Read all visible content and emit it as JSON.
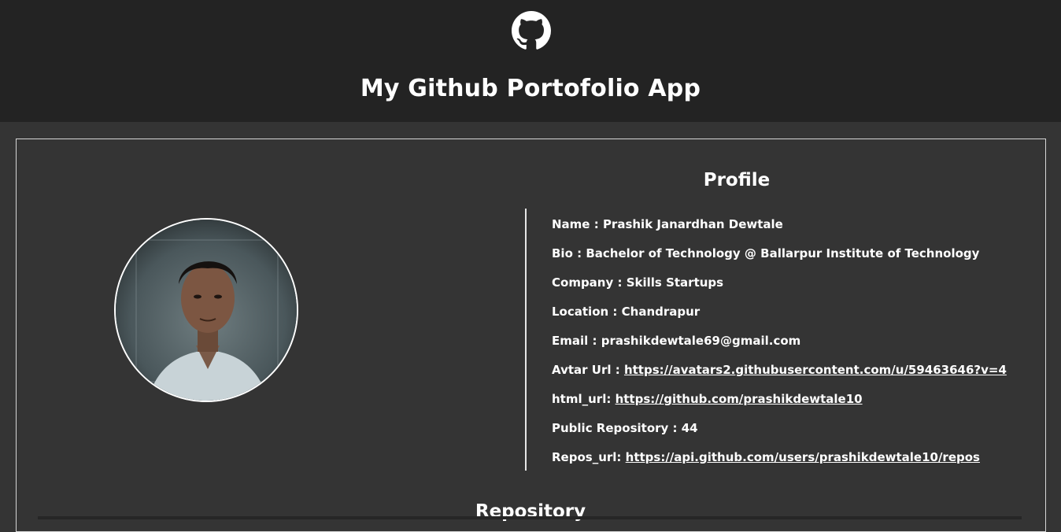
{
  "header": {
    "logo_icon": "github-octocat-icon",
    "title": "My Github Portofolio App"
  },
  "profile": {
    "heading": "Profile",
    "avatar_icon": "profile-photo",
    "fields": [
      {
        "label": "Name :",
        "value": "Prashik Janardhan Dewtale"
      },
      {
        "label": "Bio :",
        "value": "Bachelor of Technology @ Ballarpur Institute of Technology"
      },
      {
        "label": "Company :",
        "value": "Skills Startups"
      },
      {
        "label": "Location :",
        "value": "Chandrapur"
      },
      {
        "label": "Email :",
        "value": "prashikdewtale69@gmail.com"
      },
      {
        "label": "Avtar Url :",
        "value": "https://avatars2.githubusercontent.com/u/59463646?v=4"
      },
      {
        "label": "html_url:",
        "value": "https://github.com/prashikdewtale10"
      },
      {
        "label": "Public Repository :",
        "value": "44"
      },
      {
        "label": "Repos_url:",
        "value": "https://api.github.com/users/prashikdewtale10/repos"
      }
    ]
  },
  "repository": {
    "heading": "Repository"
  },
  "colors": {
    "header_bg": "#232323",
    "page_bg": "#343434",
    "text": "#ffffff",
    "border": "#d6d6d6"
  }
}
